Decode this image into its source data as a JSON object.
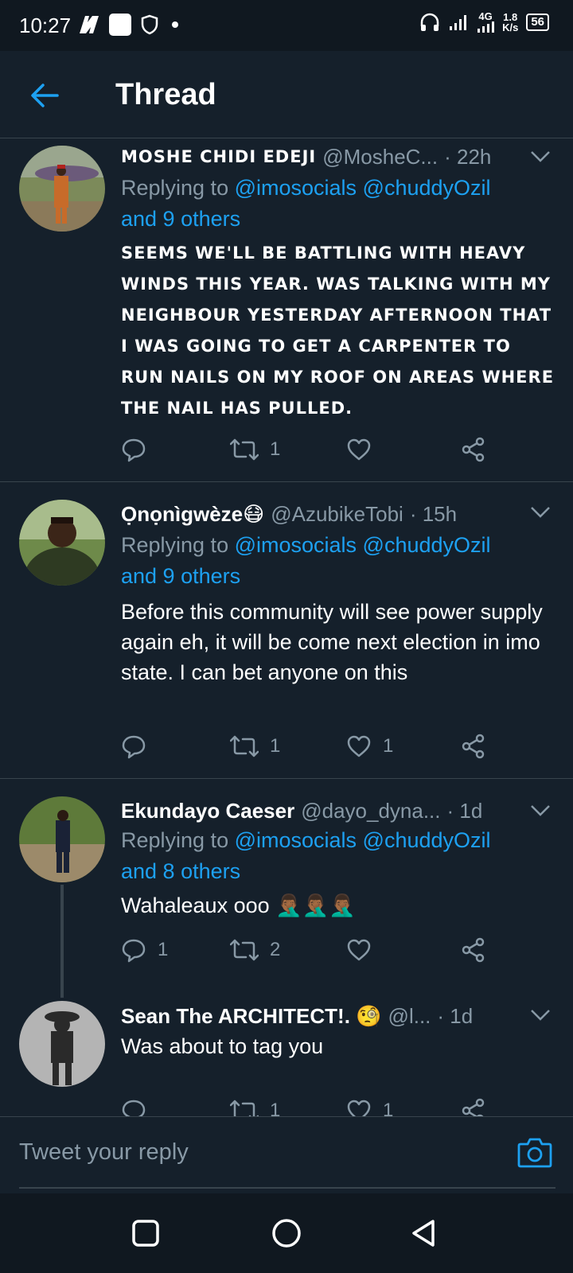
{
  "status_bar": {
    "time": "10:27",
    "network": "4G",
    "speed_value": "1.8",
    "speed_unit": "K/s",
    "battery": "56"
  },
  "header": {
    "title": "Thread"
  },
  "tweets": [
    {
      "name": "MOSHE CHIDI EDEJI",
      "handle": "@MosheC...",
      "time": "· 22h",
      "replying_prefix": "Replying to",
      "mentions": "@imosocials @chuddyOzil",
      "others": "and 9 others",
      "text": "SEEMS WE'LL BE BATTLING WITH HEAVY WINDS THIS YEAR. WAS TALKING WITH MY NEIGHBOUR YESTERDAY AFTERNOON THAT I WAS GOING TO GET A CARPENTER TO RUN NAILS ON MY ROOF ON AREAS WHERE THE NAIL HAS PULLED.",
      "replies": "",
      "retweets": "1",
      "likes": ""
    },
    {
      "name": "Ọnọnìgwèze😷",
      "handle": "@AzubikeTobi",
      "time": "· 15h",
      "replying_prefix": "Replying to",
      "mentions": "@imosocials @chuddyOzil",
      "others": "and 9 others",
      "text": "Before this community will see power supply again eh, it will be come next election in imo state. I can bet anyone on this",
      "replies": "",
      "retweets": "1",
      "likes": "1"
    },
    {
      "name": "Ekundayo Caeser",
      "handle": "@dayo_dyna...",
      "time": "· 1d",
      "replying_prefix": "Replying to",
      "mentions": "@imosocials @chuddyOzil",
      "others": "and 8 others",
      "text": "Wahaleaux ooo 🤦🏾‍♂️🤦🏾‍♂️🤦🏾‍♂️",
      "replies": "1",
      "retweets": "2",
      "likes": ""
    },
    {
      "name": "Sean The ARCHITECT!. 🧐",
      "handle": "@l...",
      "time": "· 1d",
      "text": "Was about to tag you",
      "replies": "",
      "retweets": "1",
      "likes": "1"
    }
  ],
  "reply_bar": {
    "placeholder": "Tweet your reply"
  },
  "colors": {
    "background": "#15202b",
    "accent": "#1da1f2",
    "muted": "#8899a6",
    "divider": "#38444d"
  }
}
